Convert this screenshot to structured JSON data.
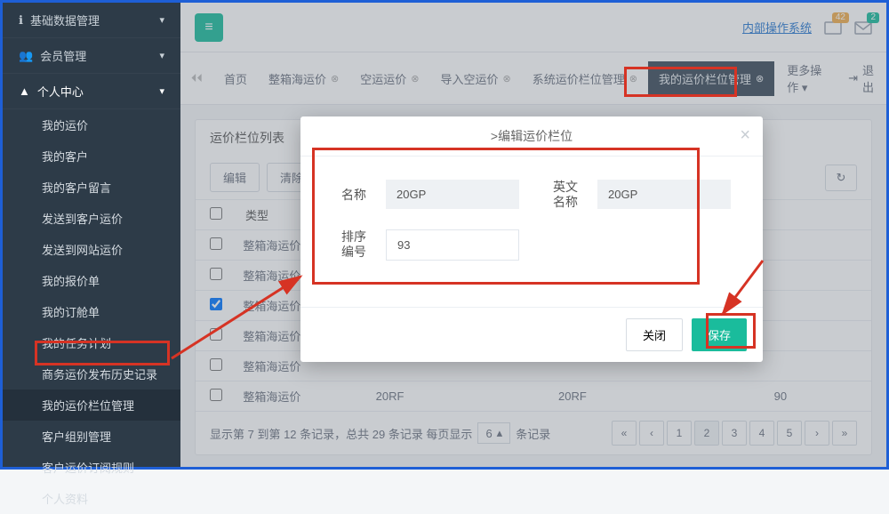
{
  "sidebar": {
    "groups": [
      {
        "label": "基础数据管理",
        "icon": "info"
      },
      {
        "label": "会员管理",
        "icon": "users"
      },
      {
        "label": "个人中心",
        "icon": "user",
        "expanded": true
      }
    ],
    "personal_items": [
      "我的运价",
      "我的客户",
      "我的客户留言",
      "发送到客户运价",
      "发送到网站运价",
      "我的报价单",
      "我的订舱单",
      "我的任务计划",
      "商务运价发布历史记录",
      "我的运价栏位管理",
      "客户组别管理",
      "客户运价订阅规则",
      "个人资料"
    ],
    "active_index": 9
  },
  "header": {
    "internal_link": "内部操作系统",
    "badge_a": "42",
    "badge_b": "2"
  },
  "tabs": {
    "items": [
      {
        "label": "首页",
        "closable": false
      },
      {
        "label": "整箱海运价",
        "closable": true
      },
      {
        "label": "空运运价",
        "closable": true
      },
      {
        "label": "导入空运价",
        "closable": true
      },
      {
        "label": "系统运价栏位管理",
        "closable": true
      },
      {
        "label": "我的运价栏位管理",
        "closable": true,
        "active": true
      }
    ],
    "more": "更多操作",
    "exit": "退出"
  },
  "panel": {
    "title": "运价栏位列表",
    "toolbar": {
      "edit": "编辑",
      "clear": "清除绑"
    },
    "columns": {
      "type": "类型",
      "name": "20RF",
      "ename": "20RF",
      "sort": "90"
    },
    "rows": [
      {
        "checked": false,
        "type": "整箱海运价"
      },
      {
        "checked": false,
        "type": "整箱海运价"
      },
      {
        "checked": true,
        "type": "整箱海运价"
      },
      {
        "checked": false,
        "type": "整箱海运价"
      },
      {
        "checked": false,
        "type": "整箱海运价"
      },
      {
        "checked": false,
        "type": "整箱海运价",
        "name": "20RF",
        "ename": "20RF",
        "sort": "90"
      }
    ],
    "pager": {
      "summary_a": "显示第 7 到第 12 条记录，总共 29 条记录  每页显示",
      "page_size": "6",
      "summary_b": "条记录",
      "pages": [
        "«",
        "‹",
        "1",
        "2",
        "3",
        "4",
        "5",
        "›",
        "»"
      ],
      "active_page": "2"
    }
  },
  "modal": {
    "title": ">编辑运价栏位",
    "labels": {
      "name": "名称",
      "ename": "英文\n名称",
      "sort": "排序\n编号"
    },
    "values": {
      "name": "20GP",
      "ename": "20GP",
      "sort": "93"
    },
    "buttons": {
      "close": "关闭",
      "save": "保存"
    }
  }
}
